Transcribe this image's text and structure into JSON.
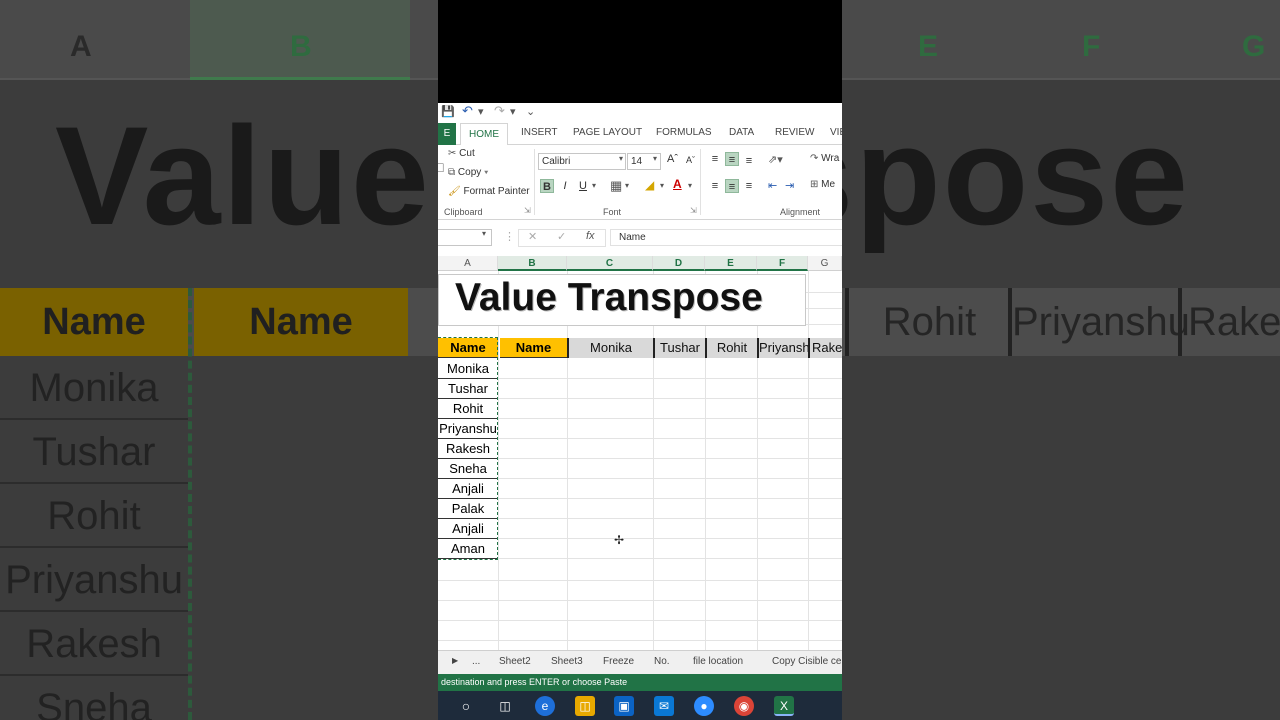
{
  "background": {
    "columns": [
      "A",
      "B",
      "E",
      "F",
      "G"
    ],
    "title": "Value Transpose",
    "header_name_a": "Name",
    "header_name_b": "Name",
    "header_right": [
      "Rohit",
      "Priyanshu",
      "Rake"
    ],
    "left_names": [
      "Monika",
      "Tushar",
      "Rohit",
      "Priyanshu",
      "Rakesh",
      "Sneha"
    ]
  },
  "qat": {
    "save_icon": "save-icon",
    "undo_icon": "undo-icon",
    "redo_icon": "redo-icon"
  },
  "ribbon_tabs": {
    "file": "E",
    "items": [
      "HOME",
      "INSERT",
      "PAGE LAYOUT",
      "FORMULAS",
      "DATA",
      "REVIEW",
      "VIE"
    ],
    "active": "HOME"
  },
  "ribbon": {
    "cut": "Cut",
    "copy": "Copy",
    "format_painter": "Format Painter",
    "clipboard_label": "Clipboard",
    "font_name": "Calibri",
    "font_size": "14",
    "font_label": "Font",
    "bold": "B",
    "italic": "I",
    "underline": "U",
    "alignment_label": "Alignment",
    "wrap": "Wra",
    "merge": "Me"
  },
  "formula_bar": {
    "name_box": "",
    "fx": "fx",
    "value": "Name"
  },
  "grid": {
    "columns": [
      "A",
      "B",
      "C",
      "D",
      "E",
      "F",
      "G"
    ],
    "selected_column": "B",
    "title": "Value Transpose",
    "header_a": "Name",
    "header_b": "Name",
    "transposed": [
      "Monika",
      "Tushar",
      "Rohit",
      "Priyanshu",
      "Rakesh"
    ],
    "names": [
      "Monika",
      "Tushar",
      "Rohit",
      "Priyanshu",
      "Rakesh",
      "Sneha",
      "Anjali",
      "Palak",
      "Anjali",
      "Aman"
    ]
  },
  "sheet_tabs": [
    "...",
    "Sheet2",
    "Sheet3",
    "Freeze",
    "No.",
    "file location",
    "Copy Cisible ce"
  ],
  "status_bar": "destination and press ENTER or choose Paste",
  "colors": {
    "excel_green": "#217346",
    "header_gold": "#ffc000",
    "header_grey": "#d9d9d9"
  }
}
